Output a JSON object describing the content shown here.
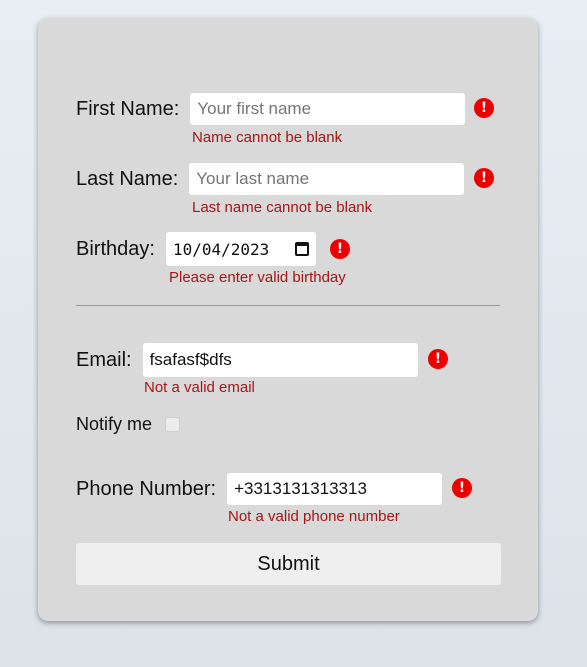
{
  "form": {
    "first_name": {
      "label": "First Name:",
      "placeholder": "Your first name",
      "value": "",
      "error": "Name cannot be blank"
    },
    "last_name": {
      "label": "Last Name:",
      "placeholder": "Your last name",
      "value": "",
      "error": "Last name cannot be blank"
    },
    "birthday": {
      "label": "Birthday:",
      "value": "10/04/2023",
      "error": "Please enter valid birthday"
    },
    "email": {
      "label": "Email:",
      "value": "fsafasf$dfs",
      "error": "Not a valid email"
    },
    "notify": {
      "label": "Notify me",
      "checked": false
    },
    "phone": {
      "label": "Phone Number:",
      "value": "+3313131313313",
      "error": "Not a valid phone number"
    },
    "error_icon_glyph": "!",
    "submit_label": "Submit"
  },
  "colors": {
    "card_bg": "#d9d9d9",
    "error_icon": "#ee0000",
    "error_text": "#a31717",
    "input_bg": "#ffffff",
    "button_bg": "#efefef"
  },
  "icons": {
    "error": "exclamation-circle-icon",
    "date_picker": "calendar-icon"
  }
}
